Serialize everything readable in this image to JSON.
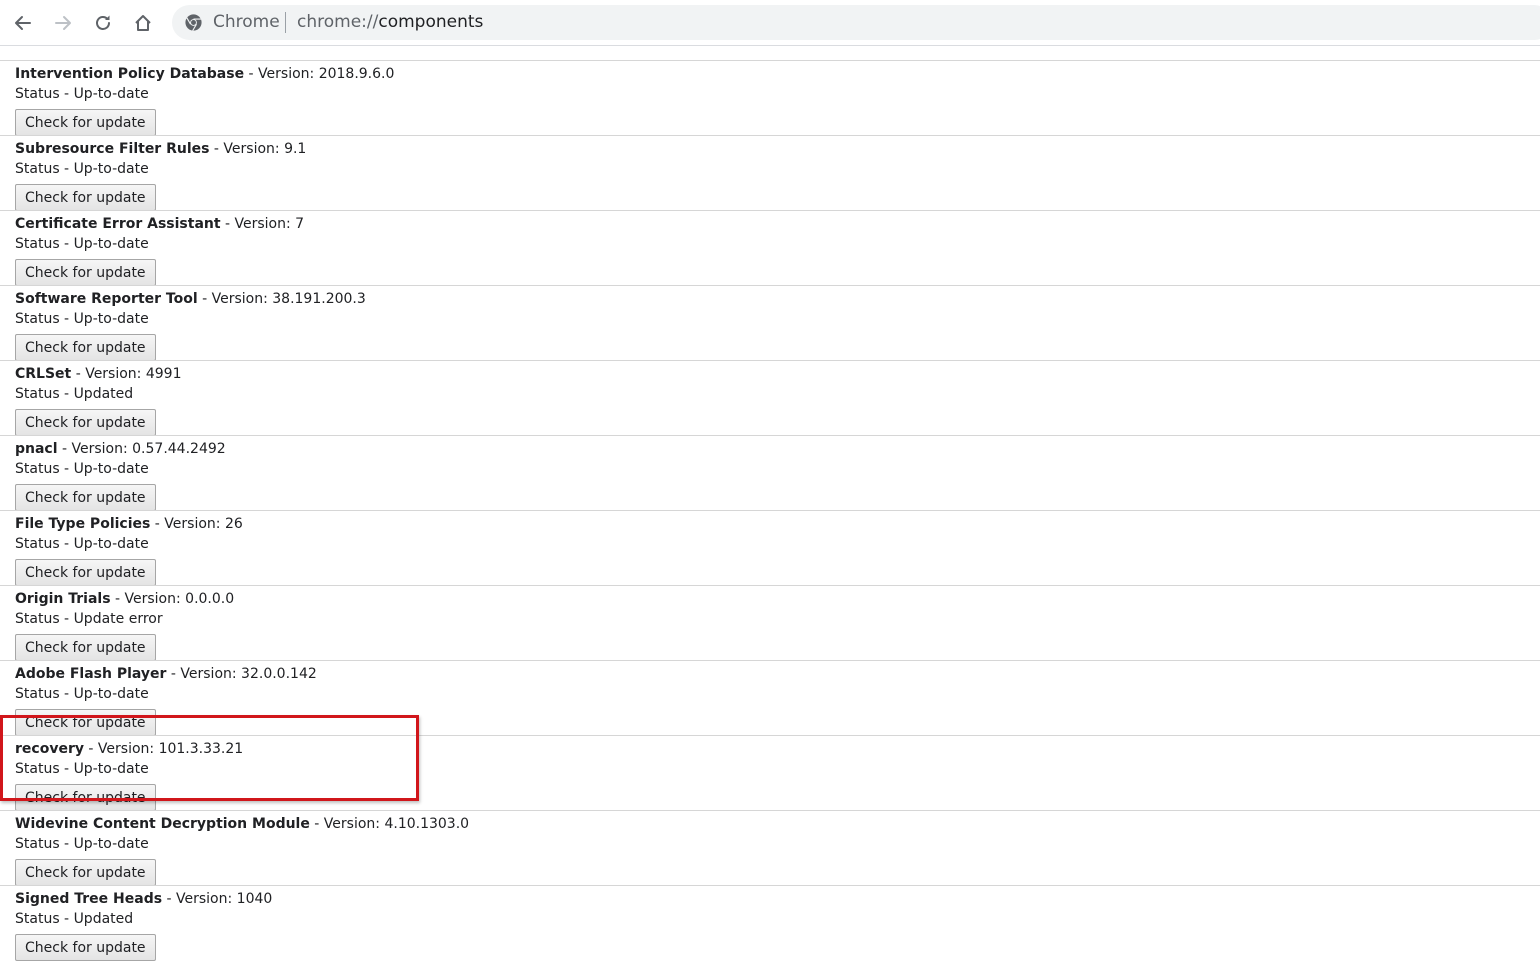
{
  "browser": {
    "chip_label": "Chrome",
    "url_scheme": "chrome://",
    "url_host": "components"
  },
  "button_label": "Check for update",
  "components": [
    {
      "name": "",
      "version_text": "",
      "status_text": ""
    },
    {
      "name": "Intervention Policy Database",
      "version_text": " - Version: 2018.9.6.0",
      "status_text": "Status - Up-to-date"
    },
    {
      "name": "Subresource Filter Rules",
      "version_text": " - Version: 9.1",
      "status_text": "Status - Up-to-date"
    },
    {
      "name": "Certificate Error Assistant",
      "version_text": " - Version: 7",
      "status_text": "Status - Up-to-date"
    },
    {
      "name": "Software Reporter Tool",
      "version_text": " - Version: 38.191.200.3",
      "status_text": "Status - Up-to-date"
    },
    {
      "name": "CRLSet",
      "version_text": " - Version: 4991",
      "status_text": "Status - Updated"
    },
    {
      "name": "pnacl",
      "version_text": " - Version: 0.57.44.2492",
      "status_text": "Status - Up-to-date"
    },
    {
      "name": "File Type Policies",
      "version_text": " - Version: 26",
      "status_text": "Status - Up-to-date"
    },
    {
      "name": "Origin Trials",
      "version_text": " - Version: 0.0.0.0",
      "status_text": "Status - Update error"
    },
    {
      "name": "Adobe Flash Player",
      "version_text": " - Version: 32.0.0.142",
      "status_text": "Status - Up-to-date"
    },
    {
      "name": "recovery",
      "version_text": " - Version: 101.3.33.21",
      "status_text": "Status - Up-to-date"
    },
    {
      "name": "Widevine Content Decryption Module",
      "version_text": " - Version: 4.10.1303.0",
      "status_text": "Status - Up-to-date"
    },
    {
      "name": "Signed Tree Heads",
      "version_text": " - Version: 1040",
      "status_text": "Status - Updated"
    }
  ],
  "highlight_color": "#d1161b"
}
